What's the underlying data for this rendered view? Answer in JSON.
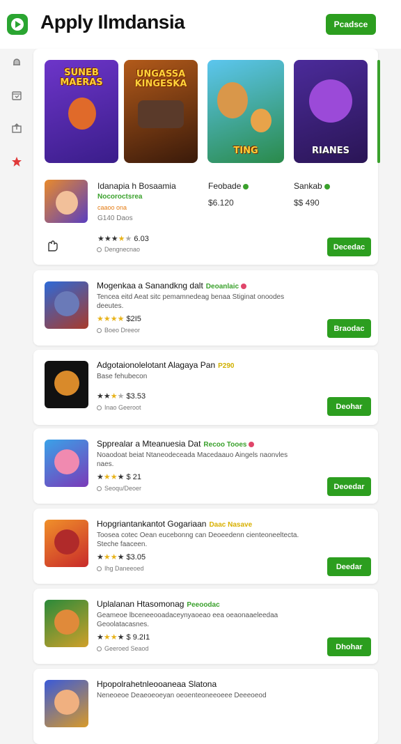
{
  "header": {
    "title": "Apply Ilmdansia",
    "action_label": "Pcadsce"
  },
  "featured": {
    "covers": [
      {
        "title": "SUNEB MAERAS",
        "bg": "#5c2fb3"
      },
      {
        "title": "UNGASSA KINGESKA",
        "bg": "#8a3a14"
      },
      {
        "title": "TING",
        "bg": "#2aa0d8"
      },
      {
        "title": "RIANES",
        "bg": "#3b1f7a"
      }
    ],
    "main_name": "Idanapia h Bosaamia",
    "main_green": "Nocoroctsrea",
    "main_orange": "caaoo ona",
    "main_grey": "G140 Daos",
    "rating": "6.03",
    "rating_meta": "Dengnecnao",
    "col2_name": "Feobade",
    "col2_price": "$6.120",
    "col3_name": "Sankab",
    "col3_price": "$$ 490",
    "button": "Decedac"
  },
  "rows": [
    {
      "title": "Mogenkaa a Sanandkng dalt",
      "tag": "Deoanlaic",
      "tag_color": "#3aa12c",
      "desc": "Tencea eitd Aeat sitc pemamnedeag benaa Stiginat onoodes deeutes.",
      "price": "$2I5",
      "meta": "Boeo Dreeor",
      "button": "Braodac"
    },
    {
      "title": "Adgotaionolelotant Alagaya Pan",
      "tag": "P290",
      "tag_color": "#d0b000",
      "desc": "Base fehubecon",
      "price": "$3.53",
      "meta": "Inao Geeroot",
      "button": "Deohar"
    },
    {
      "title": "Spprealar a Mteanuesia Dat",
      "tag": "Recoo Tooes",
      "tag_color": "#3aa12c",
      "desc": "Noaodoat beiat Ntaneodeceada Macedaauo Aingels naonvles naes.",
      "price": "$ 21",
      "meta": "Seoqu/Deoer",
      "button": "Deoedar"
    },
    {
      "title": "Hopgriantankantot Gogariaan",
      "tag": "Daac Nasave",
      "tag_color": "#d8b000",
      "desc": "Toosea cotec Oean eucebonng can Deoeedenn cienteoneeltecta. Steche faaceen.",
      "price": "$3.05",
      "meta": "Ihg Daneeoed",
      "button": "Deedar"
    },
    {
      "title": "Uplalanan Htasomonag",
      "tag": "Peeoodac",
      "tag_color": "#3aa12c",
      "desc": "Geameoe lbceneeooadaceynyaoeao eea oeaonaaeleedaa Geoolatacasnes.",
      "price": "$ 9.2I1",
      "meta": "Geeroed Seaod",
      "button": "Dhohar"
    },
    {
      "title": "Hpopolrahetnleooaneaa Slatona",
      "tag": "",
      "tag_color": "#3aa12c",
      "desc": "Neneoeoe Deaeoeoeyan oeoenteoneeoeee Deeeoeod",
      "price": "",
      "meta": "",
      "button": ""
    }
  ]
}
